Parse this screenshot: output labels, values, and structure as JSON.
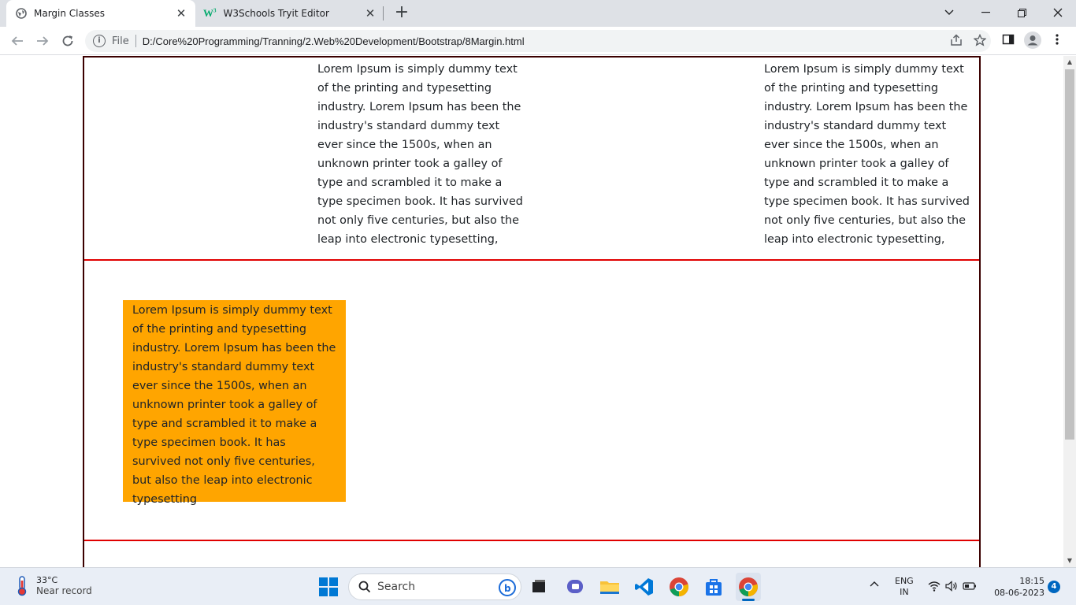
{
  "browser": {
    "tabs": [
      {
        "title": "Margin Classes",
        "icon": "globe-icon",
        "active": true
      },
      {
        "title": "W3Schools Tryit Editor",
        "icon": "w3schools-icon",
        "active": false
      }
    ],
    "new_tab_glyph": "+",
    "omnibox": {
      "scheme_label": "File",
      "url": "D:/Core%20Programming/Tranning/2.Web%20Development/Bootstrap/8Margin.html"
    }
  },
  "page": {
    "paragraphs": {
      "row1_col_a": "Lorem Ipsum is simply dummy text of the printing and typesetting industry. Lorem Ipsum has been the industry's standard dummy text ever since the 1500s, when an unknown printer took a galley of type and scrambled it to make a type specimen book. It has survived not only five centuries, but also the leap into electronic typesetting,",
      "row1_col_b": "Lorem Ipsum is simply dummy text of the printing and typesetting industry. Lorem Ipsum has been the industry's standard dummy text ever since the 1500s, when an unknown printer took a galley of type and scrambled it to make a type specimen book. It has survived not only five centuries, but also the leap into electronic typesetting,",
      "row2_box": "Lorem Ipsum is simply dummy text of the printing and typesetting industry. Lorem Ipsum has been the industry's standard dummy text ever since the 1500s, when an unknown printer took a galley of type and scrambled it to make a type specimen book. It has survived not only five centuries, but also the leap into electronic typesetting"
    },
    "colors": {
      "container_border": "#3b0000",
      "row_border": "#e00000",
      "box_bg": "#ffa500"
    }
  },
  "taskbar": {
    "weather": {
      "temp": "33°C",
      "condition": "Near record"
    },
    "search_label": "Search",
    "language": {
      "line1": "ENG",
      "line2": "IN"
    },
    "clock": {
      "time": "18:15",
      "date": "08-06-2023"
    },
    "notification_count": "4"
  }
}
